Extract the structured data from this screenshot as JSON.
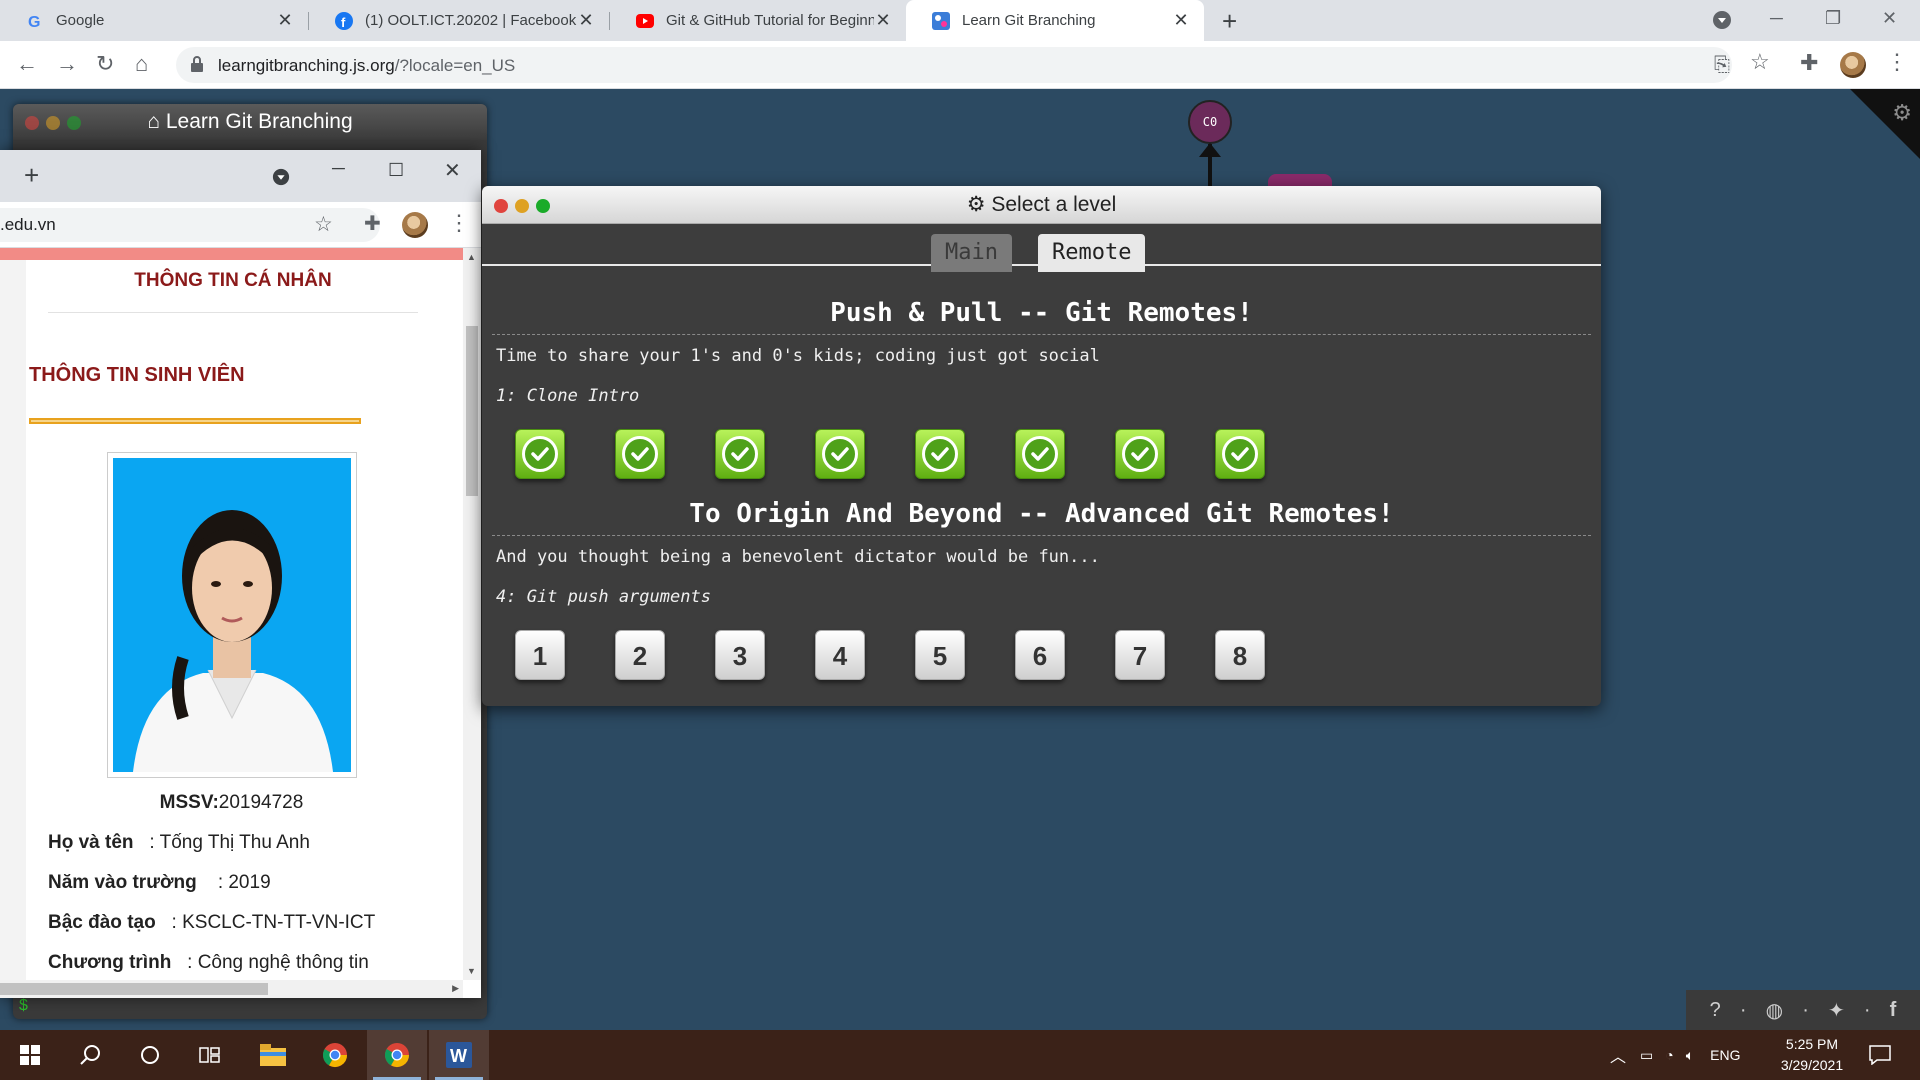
{
  "browser": {
    "tabs": [
      {
        "title": "Google",
        "active": false
      },
      {
        "title": "(1) OOLT.ICT.20202 | Facebook",
        "active": false
      },
      {
        "title": "Git & GitHub Tutorial for Beginners",
        "active": false
      },
      {
        "title": "Learn Git Branching",
        "active": true
      }
    ],
    "url_host": "learngitbranching.js.org",
    "url_rest": "/?locale=en_US"
  },
  "background_app": {
    "title": "Learn Git Branching",
    "commit_label": "C0",
    "prompt_symbol": "$"
  },
  "student_window": {
    "url_fragment": ".edu.vn",
    "heading_personal": "THÔNG TIN CÁ NHÂN",
    "heading_student": "THÔNG TIN SINH VIÊN",
    "mssv_label": "MSSV:",
    "mssv_value": "20194728",
    "fields": [
      {
        "label": "Họ và tên",
        "value": ": Tống Thị Thu Anh"
      },
      {
        "label": "Năm vào trường",
        "value": ": 2019"
      },
      {
        "label": "Bậc đào tạo",
        "value": ": KSCLC-TN-TT-VN-ICT"
      },
      {
        "label": "Chương trình",
        "value": ": Công nghệ thông tin"
      }
    ]
  },
  "level_modal": {
    "title": "Select a level",
    "tabs": {
      "main": "Main",
      "remote": "Remote"
    },
    "sequences": [
      {
        "title": "Push & Pull -- Git Remotes!",
        "description": "Time to share your 1's and 0's kids; coding just got social",
        "selected_level": "1: Clone Intro",
        "levels": [
          "done",
          "done",
          "done",
          "done",
          "done",
          "done",
          "done",
          "done"
        ]
      },
      {
        "title": "To Origin And Beyond -- Advanced Git Remotes!",
        "description": "And you thought being a benevolent dictator would be fun...",
        "selected_level": "4: Git push arguments",
        "levels": [
          "1",
          "2",
          "3",
          "4",
          "5",
          "6",
          "7",
          "8"
        ]
      }
    ]
  },
  "help_bar": {
    "icons": [
      "help-icon",
      "globe-icon",
      "twitter-icon",
      "facebook-icon"
    ]
  },
  "taskbar": {
    "language": "ENG",
    "time": "5:25 PM",
    "date": "3/29/2021"
  },
  "colors": {
    "page_bg": "#2c4a62",
    "modal_bg": "#3d3d3d",
    "heading_red": "#8b1a1a",
    "done_green": "#6cc21e"
  }
}
